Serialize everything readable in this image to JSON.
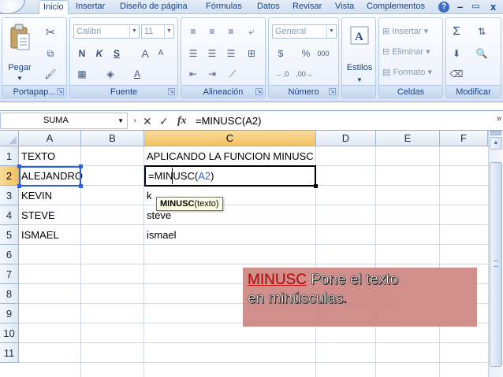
{
  "menubar": {
    "tabs": [
      {
        "label": "Inicio",
        "active": true
      },
      {
        "label": "Insertar",
        "active": false
      },
      {
        "label": "Diseño de página",
        "active": false
      },
      {
        "label": "Fórmulas",
        "active": false
      },
      {
        "label": "Datos",
        "active": false
      },
      {
        "label": "Revisar",
        "active": false
      },
      {
        "label": "Vista",
        "active": false
      },
      {
        "label": "Complementos",
        "active": false
      }
    ],
    "help_glyph": "?",
    "minimize_glyph": "–",
    "close_glyph": "x"
  },
  "ribbon": {
    "portapapeles": {
      "label": "Portapap...",
      "paste_label": "Pegar"
    },
    "fuente": {
      "label": "Fuente",
      "font_name": "Calibri",
      "font_size": "11",
      "bold": "N",
      "italic": "K",
      "underline": "S",
      "grow": "A",
      "shrink": "A"
    },
    "alineacion": {
      "label": "Alineación"
    },
    "numero": {
      "label": "Número",
      "format": "General",
      "currency": "$",
      "percent": "%",
      "thousands": "000"
    },
    "estilos": {
      "label": "Estilos",
      "button": "Estilos"
    },
    "celdas": {
      "label": "Celdas",
      "insert": "Insertar",
      "delete": "Eliminar",
      "format": "Formato"
    },
    "modificar": {
      "label": "Modificar",
      "sum": "Σ"
    }
  },
  "formula_bar": {
    "name_box": "SUMA",
    "cancel_glyph": "✕",
    "enter_glyph": "✓",
    "fx_glyph": "fx",
    "formula": "=MINUSC(A2)"
  },
  "grid": {
    "columns": [
      "A",
      "B",
      "C",
      "D",
      "E",
      "F"
    ],
    "rows": [
      "1",
      "2",
      "3",
      "4",
      "5",
      "6",
      "7",
      "8",
      "9",
      "10",
      "11"
    ],
    "cells": {
      "A1": "TEXTO",
      "A2": "ALEJANDRO",
      "A3": "KEVIN",
      "A4": "STEVE",
      "A5": "ISMAEL",
      "C1": "APLICANDO LA FUNCION MINUSC",
      "C2_prefix": "=MINUSC(",
      "C2_ref": "A2",
      "C2_suffix": ")",
      "C3": "k",
      "C4": "steve",
      "C5": "ismael"
    },
    "tooltip": {
      "fn": "MINUSC",
      "args": "(texto)"
    },
    "colors": {
      "ref_blue": "#2f5fd6",
      "header_selected": "#f2c15f"
    }
  },
  "annotation": {
    "keyword": "MINUSC",
    "line1_rest": " Pone el texto",
    "line2": "en minúsculas",
    "line2_end": "."
  }
}
